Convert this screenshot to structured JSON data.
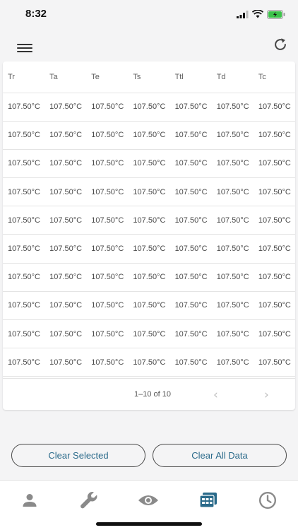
{
  "status_bar": {
    "time": "8:32"
  },
  "table": {
    "headers": [
      "Tr",
      "Ta",
      "Te",
      "Ts",
      "Ttl",
      "Td",
      "Tc"
    ],
    "rows": [
      [
        "107.50°C",
        "107.50°C",
        "107.50°C",
        "107.50°C",
        "107.50°C",
        "107.50°C",
        "107.50°C"
      ],
      [
        "107.50°C",
        "107.50°C",
        "107.50°C",
        "107.50°C",
        "107.50°C",
        "107.50°C",
        "107.50°C"
      ],
      [
        "107.50°C",
        "107.50°C",
        "107.50°C",
        "107.50°C",
        "107.50°C",
        "107.50°C",
        "107.50°C"
      ],
      [
        "107.50°C",
        "107.50°C",
        "107.50°C",
        "107.50°C",
        "107.50°C",
        "107.50°C",
        "107.50°C"
      ],
      [
        "107.50°C",
        "107.50°C",
        "107.50°C",
        "107.50°C",
        "107.50°C",
        "107.50°C",
        "107.50°C"
      ],
      [
        "107.50°C",
        "107.50°C",
        "107.50°C",
        "107.50°C",
        "107.50°C",
        "107.50°C",
        "107.50°C"
      ],
      [
        "107.50°C",
        "107.50°C",
        "107.50°C",
        "107.50°C",
        "107.50°C",
        "107.50°C",
        "107.50°C"
      ],
      [
        "107.50°C",
        "107.50°C",
        "107.50°C",
        "107.50°C",
        "107.50°C",
        "107.50°C",
        "107.50°C"
      ],
      [
        "107.50°C",
        "107.50°C",
        "107.50°C",
        "107.50°C",
        "107.50°C",
        "107.50°C",
        "107.50°C"
      ],
      [
        "107.50°C",
        "107.50°C",
        "107.50°C",
        "107.50°C",
        "107.50°C",
        "107.50°C",
        "107.50°C"
      ]
    ]
  },
  "pagination": {
    "range_label": "1–10 of 10",
    "prev_icon": "chevron-left-icon",
    "next_icon": "chevron-right-icon"
  },
  "actions": {
    "clear_selected_label": "Clear Selected",
    "clear_all_label": "Clear All Data"
  },
  "tab_bar": {
    "tabs": [
      {
        "icon": "person-icon",
        "active": false
      },
      {
        "icon": "wrench-icon",
        "active": false
      },
      {
        "icon": "eye-icon",
        "active": false
      },
      {
        "icon": "data-table-icon",
        "active": true
      },
      {
        "icon": "clock-icon",
        "active": false
      }
    ]
  },
  "colors": {
    "active_tab": "#2a6a8a",
    "inactive_tab": "#8a8a8a",
    "button_text": "#2a6a8a"
  }
}
